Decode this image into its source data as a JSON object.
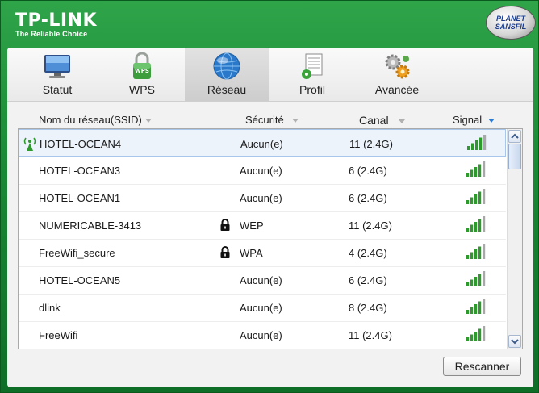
{
  "brand": {
    "name": "TP-LINK",
    "tagline": "The Reliable Choice"
  },
  "badge": {
    "line1": "PLANET",
    "line2": "SANSFIL"
  },
  "tabs": [
    {
      "label": "Statut",
      "icon": "monitor-icon",
      "active": false
    },
    {
      "label": "WPS",
      "icon": "wps-lock-icon",
      "active": false
    },
    {
      "label": "Réseau",
      "icon": "globe-icon",
      "active": true
    },
    {
      "label": "Profil",
      "icon": "profile-document-icon",
      "active": false
    },
    {
      "label": "Avancée",
      "icon": "gears-icon",
      "active": false
    }
  ],
  "columns": {
    "ssid": "Nom du réseau(SSID)",
    "security": "Sécurité",
    "channel": "Canal",
    "signal": "Signal"
  },
  "networks": [
    {
      "ssid": "HOTEL-OCEAN4",
      "security": "Aucun(e)",
      "channel": "11 (2.4G)",
      "locked": false,
      "connected": true
    },
    {
      "ssid": "HOTEL-OCEAN3",
      "security": "Aucun(e)",
      "channel": "6 (2.4G)",
      "locked": false,
      "connected": false
    },
    {
      "ssid": "HOTEL-OCEAN1",
      "security": "Aucun(e)",
      "channel": "6 (2.4G)",
      "locked": false,
      "connected": false
    },
    {
      "ssid": "NUMERICABLE-3413",
      "security": "WEP",
      "channel": "11 (2.4G)",
      "locked": true,
      "connected": false
    },
    {
      "ssid": "FreeWifi_secure",
      "security": "WPA",
      "channel": "4 (2.4G)",
      "locked": true,
      "connected": false
    },
    {
      "ssid": "HOTEL-OCEAN5",
      "security": "Aucun(e)",
      "channel": "6 (2.4G)",
      "locked": false,
      "connected": false
    },
    {
      "ssid": "dlink",
      "security": "Aucun(e)",
      "channel": "8 (2.4G)",
      "locked": false,
      "connected": false
    },
    {
      "ssid": "FreeWifi",
      "security": "Aucun(e)",
      "channel": "11 (2.4G)",
      "locked": false,
      "connected": false
    }
  ],
  "rescan_label": "Rescanner",
  "colors": {
    "frame_green": "#1a8a36",
    "signal_green": "#2e9a2e",
    "accent_blue": "#2a7bd6"
  }
}
